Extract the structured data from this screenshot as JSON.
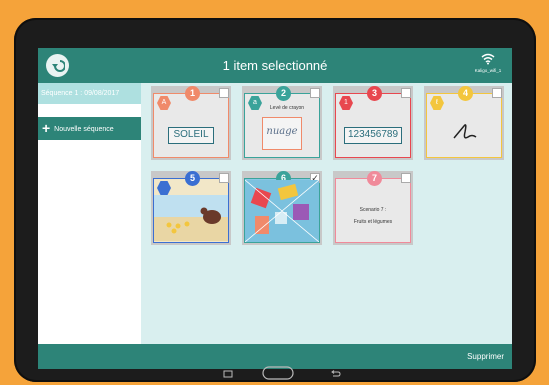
{
  "header": {
    "title": "1 item selectionné",
    "wifi_label": "Kaligo_wifi_1"
  },
  "sidebar": {
    "sequence_tab": "Séquence 1 : 09/08/2017",
    "new_sequence": "Nouvelle séquence"
  },
  "cards": [
    {
      "number": "1",
      "hex": "A",
      "color": "#f08a6a",
      "content": "SOLEIL",
      "checked": false
    },
    {
      "number": "2",
      "hex": "a",
      "color": "#3aa39a",
      "caption": "Levé de crayon",
      "content": "nuage",
      "checked": false
    },
    {
      "number": "3",
      "hex": "1",
      "color": "#e8474f",
      "content": "123456789",
      "checked": false
    },
    {
      "number": "4",
      "hex": "ℓ",
      "color": "#f3c63e",
      "content": "ℓ",
      "checked": false
    },
    {
      "number": "5",
      "hex": "",
      "color": "#3b6fd2",
      "checked": false
    },
    {
      "number": "6",
      "hex": "",
      "color": "#3aa39a",
      "checked": true
    },
    {
      "number": "7",
      "hex": "",
      "color": "#f08a9a",
      "line1": "Scenario 7 :",
      "line2": "Fruits et légumes",
      "checked": false
    }
  ],
  "footer": {
    "delete": "Supprimer"
  }
}
